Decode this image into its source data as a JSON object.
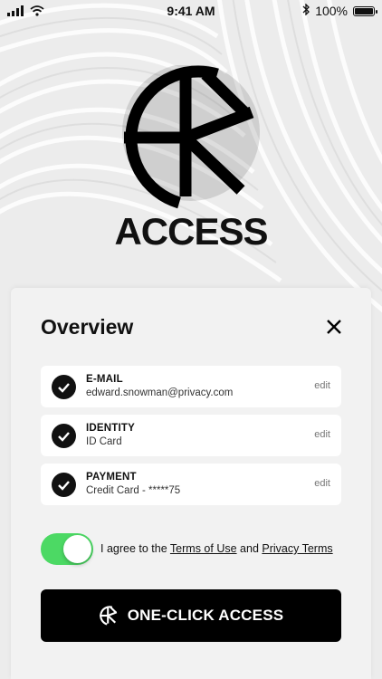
{
  "status_bar": {
    "time": "9:41 AM",
    "battery_percent": "100%"
  },
  "logo": {
    "text": "ACCESS"
  },
  "overview": {
    "title": "Overview",
    "items": [
      {
        "label": "E-MAIL",
        "value": "edward.snowman@privacy.com",
        "action": "edit"
      },
      {
        "label": "IDENTITY",
        "value": "ID Card",
        "action": "edit"
      },
      {
        "label": "PAYMENT",
        "value": "Credit Card - *****75",
        "action": "edit"
      }
    ],
    "consent": {
      "enabled": true,
      "prefix": "I agree to the ",
      "terms_link": "Terms of Use",
      "conjunction": " and ",
      "privacy_link": "Privacy Terms"
    },
    "cta_label": "ONE-CLICK ACCESS"
  },
  "colors": {
    "toggle_on": "#4cd964",
    "cta_background": "#000000"
  }
}
